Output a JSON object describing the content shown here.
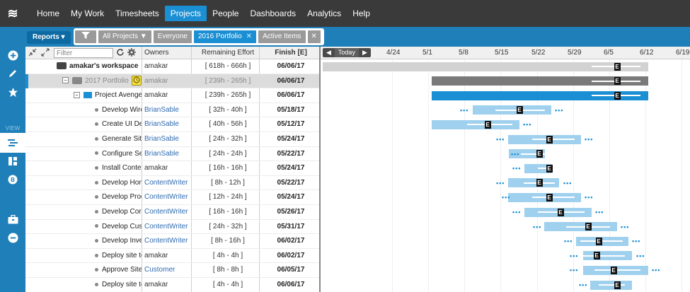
{
  "nav": {
    "logo": "≋",
    "items": [
      "Home",
      "My Work",
      "Timesheets",
      "Projects",
      "People",
      "Dashboards",
      "Analytics",
      "Help"
    ],
    "active": "Projects"
  },
  "filterbar": {
    "reports_label": "Reports ▾",
    "funnel_icon": "funnel-icon",
    "chips": [
      "All Projects ▼",
      "Everyone",
      "2016 Portfolio",
      "Active Items"
    ],
    "chip_close": "✕",
    "clear_icon": "✕"
  },
  "leftrail": {
    "view_label": "VIEW"
  },
  "grid": {
    "search_placeholder": "Filter",
    "headers": {
      "owners": "Owners",
      "effort": "Remaining Effort",
      "finish": "Finish [E]"
    },
    "rows": [
      {
        "name": "amakar's workspace",
        "owner": "amakar",
        "effort": "[ 618h - 666h ]",
        "finish": "06/06/17",
        "type": "workspace"
      },
      {
        "name": "2017 Portfolio",
        "owner": "amakar",
        "effort": "[ 239h - 265h ]",
        "finish": "06/06/17",
        "type": "portfolio",
        "toggle": "−"
      },
      {
        "name": "Project Avengers",
        "owner": "amakar",
        "effort": "[ 239h - 265h ]",
        "finish": "06/06/17",
        "type": "project",
        "toggle": "−"
      },
      {
        "name": "Develop Wiref",
        "owner": "BrianSable",
        "effort": "[ 32h - 40h ]",
        "finish": "05/18/17",
        "type": "task",
        "ownerLink": true
      },
      {
        "name": "Create UI Des",
        "owner": "BrianSable",
        "effort": "[ 40h - 56h ]",
        "finish": "05/12/17",
        "type": "task",
        "ownerLink": true
      },
      {
        "name": "Generate Site",
        "owner": "BrianSable",
        "effort": "[ 24h - 32h ]",
        "finish": "05/24/17",
        "type": "task",
        "ownerLink": true
      },
      {
        "name": "Configure Ser",
        "owner": "BrianSable",
        "effort": "[ 24h - 24h ]",
        "finish": "05/22/17",
        "type": "task",
        "ownerLink": true
      },
      {
        "name": "Install Content",
        "owner": "amakar",
        "effort": "[ 16h - 16h ]",
        "finish": "05/24/17",
        "type": "task",
        "ownerLink": false
      },
      {
        "name": "Develop Home",
        "owner": "ContentWriter",
        "effort": "[ 8h - 12h ]",
        "finish": "05/22/17",
        "type": "task",
        "ownerLink": true
      },
      {
        "name": "Develop Prodc",
        "owner": "ContentWriter",
        "effort": "[ 12h - 24h ]",
        "finish": "05/24/17",
        "type": "task",
        "ownerLink": true
      },
      {
        "name": "Develop Corp",
        "owner": "ContentWriter",
        "effort": "[ 16h - 16h ]",
        "finish": "05/26/17",
        "type": "task",
        "ownerLink": true
      },
      {
        "name": "Develop Custo",
        "owner": "ContentWriter",
        "effort": "[ 24h - 32h ]",
        "finish": "05/31/17",
        "type": "task",
        "ownerLink": true
      },
      {
        "name": "Develop Inves",
        "owner": "ContentWriter",
        "effort": "[ 8h - 16h ]",
        "finish": "06/02/17",
        "type": "task",
        "ownerLink": true
      },
      {
        "name": "Deploy site to",
        "owner": "amakar",
        "effort": "[ 4h - 4h ]",
        "finish": "06/02/17",
        "type": "task",
        "ownerLink": false
      },
      {
        "name": "Approve Site f",
        "owner": "Customer",
        "effort": "[ 8h - 8h ]",
        "finish": "06/05/17",
        "type": "task",
        "ownerLink": true
      },
      {
        "name": "Deploy site to",
        "owner": "amakar",
        "effort": "[ 4h - 4h ]",
        "finish": "06/06/17",
        "type": "task",
        "ownerLink": false
      }
    ]
  },
  "gantt": {
    "today_label": "Today",
    "prev": "◀",
    "next": "▶",
    "dates": [
      "4/24",
      "5/1",
      "5/8",
      "5/15",
      "5/22",
      "5/29",
      "6/5",
      "6/12",
      "6/19"
    ],
    "marker_label": "E",
    "dots": "•••"
  }
}
